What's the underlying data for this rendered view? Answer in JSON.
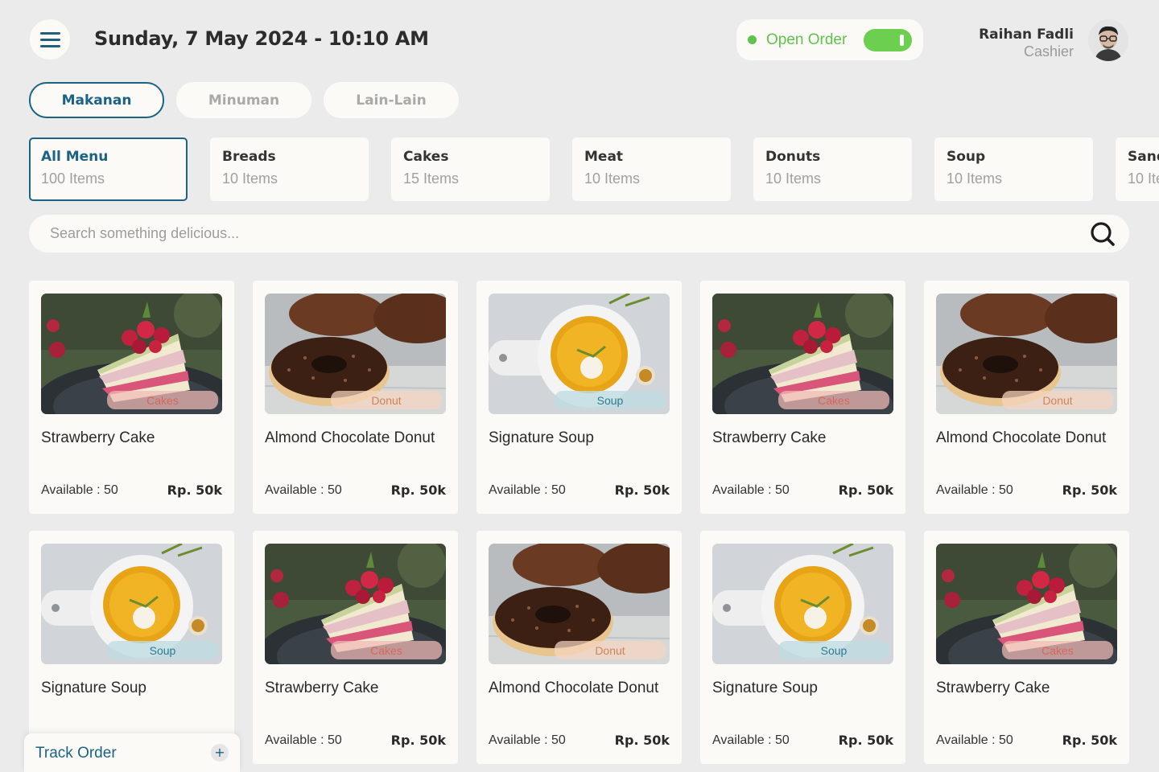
{
  "header": {
    "datetime": "Sunday, 7 May 2024 - 10:10 AM",
    "open_order_label": "Open Order",
    "open_order_on": true,
    "user_name": "Raihan Fadli",
    "user_role": "Cashier"
  },
  "main_tabs": [
    {
      "label": "Makanan",
      "active": true
    },
    {
      "label": "Minuman",
      "active": false
    },
    {
      "label": "Lain-Lain",
      "active": false
    }
  ],
  "categories": [
    {
      "name": "All Menu",
      "count": "100 Items",
      "active": true
    },
    {
      "name": "Breads",
      "count": "10 Items"
    },
    {
      "name": "Cakes",
      "count": "15 Items"
    },
    {
      "name": "Meat",
      "count": "10 Items"
    },
    {
      "name": "Donuts",
      "count": "10 Items"
    },
    {
      "name": "Soup",
      "count": "10 Items"
    },
    {
      "name": "Sand",
      "count": "10 Ite"
    }
  ],
  "search": {
    "placeholder": "Search something delicious..."
  },
  "products": [
    {
      "name": "Strawberry Cake",
      "tag": "Cakes",
      "available": "Available : 50",
      "price": "Rp. 50k"
    },
    {
      "name": "Almond Chocolate Donut",
      "tag": "Donut",
      "available": "Available : 50",
      "price": "Rp. 50k"
    },
    {
      "name": "Signature Soup",
      "tag": "Soup",
      "available": "Available : 50",
      "price": "Rp. 50k"
    },
    {
      "name": "Strawberry Cake",
      "tag": "Cakes",
      "available": "Available : 50",
      "price": "Rp. 50k"
    },
    {
      "name": "Almond Chocolate Donut",
      "tag": "Donut",
      "available": "Available : 50",
      "price": "Rp. 50k"
    },
    {
      "name": "Signature Soup",
      "tag": "Soup",
      "available": "",
      "price": ""
    },
    {
      "name": "Strawberry Cake",
      "tag": "Cakes",
      "available": "Available : 50",
      "price": "Rp. 50k"
    },
    {
      "name": "Almond Chocolate Donut",
      "tag": "Donut",
      "available": "Available : 50",
      "price": "Rp. 50k"
    },
    {
      "name": "Signature Soup",
      "tag": "Soup",
      "available": "Available : 50",
      "price": "Rp. 50k"
    },
    {
      "name": "Strawberry Cake",
      "tag": "Cakes",
      "available": "Available : 50",
      "price": "Rp. 50k"
    }
  ],
  "track_order": {
    "label": "Track Order",
    "plus": "+"
  },
  "colors": {
    "accent": "#1b6285",
    "open": "#5fc24a",
    "background": "#ebebeb",
    "card": "#fbfaf7"
  }
}
